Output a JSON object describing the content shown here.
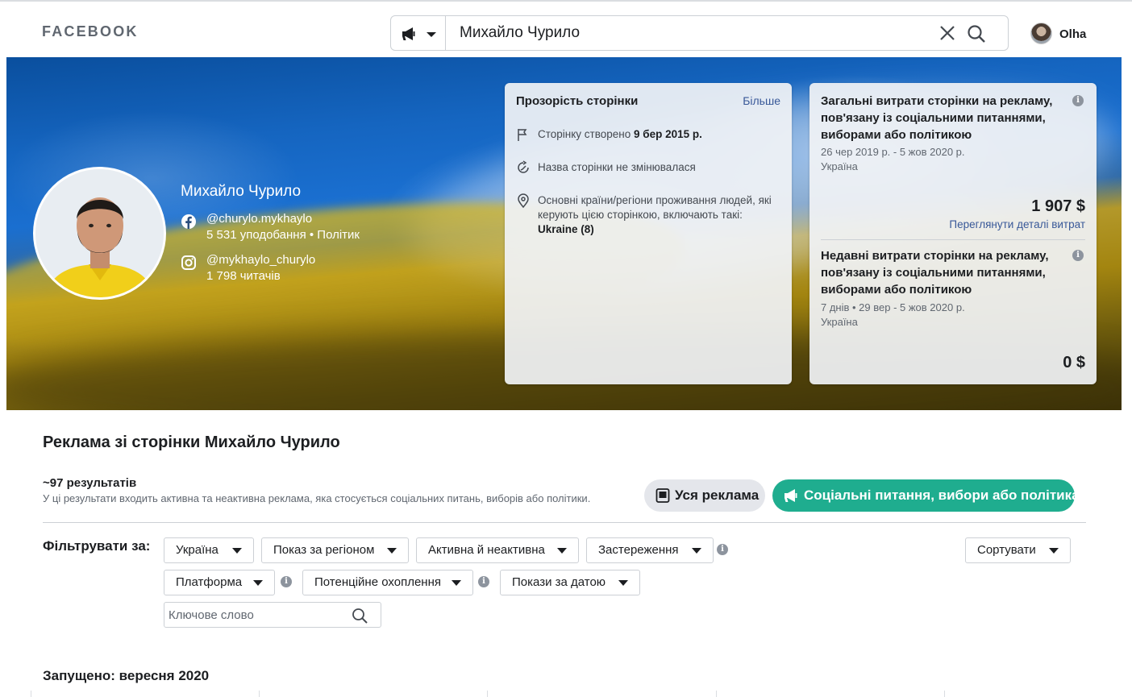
{
  "header": {
    "logo": "FACEBOOK",
    "search_value": "Михайло Чурило",
    "search_type_icon": "megaphone-icon",
    "user_name": "Olha"
  },
  "profile": {
    "name": "Михайло Чурило",
    "facebook_handle": "@churylo.mykhaylo",
    "facebook_stats": "5 531 уподобання • Політик",
    "instagram_handle": "@mykhaylo_churylo",
    "instagram_stats": "1 798 читачів"
  },
  "transparency": {
    "title": "Прозорість сторінки",
    "more": "Більше",
    "created_prefix": "Сторінку створено",
    "created_date": "9 бер 2015 р.",
    "name_unchanged": "Назва сторінки не змінювалася",
    "countries_text": "Основні країни/регіони проживання людей, які керують цією сторінкою, включають такі:",
    "countries_value": "Ukraine (8)"
  },
  "spending": {
    "total_title": "Загальні витрати сторінки на рекламу, пов'язану із соціальними питаннями, виборами або політикою",
    "total_period": "26 чер 2019 р. - 5 жов 2020 р.",
    "total_region": "Україна",
    "total_amount": "1 907 $",
    "details_link": "Переглянути деталі витрат",
    "recent_title": "Недавні витрати сторінки на рекламу, пов'язану із соціальними питаннями, виборами або політикою",
    "recent_period": "7 днів • 29 вер - 5 жов 2020 р.",
    "recent_region": "Україна",
    "recent_amount": "0 $"
  },
  "ads": {
    "title": "Реклама зі сторінки Михайло Чурило",
    "results": "~97 результатів",
    "results_desc": "У ці результати входить активна та неактивна реклама, яка стосується соціальних питань, виборів або політики.",
    "all_ads": "Уся реклама",
    "political_ads": "Соціальні питання, вибори або політика"
  },
  "filters": {
    "label": "Фільтрувати за:",
    "country": "Україна",
    "region": "Показ за регіоном",
    "status": "Активна й неактивна",
    "disclaimer": "Застереження",
    "sort": "Сортувати",
    "platform": "Платформа",
    "reach": "Потенційне охоплення",
    "date": "Покази за датою",
    "keyword_placeholder": "Ключове слово",
    "info_glyph": "i"
  },
  "launched": "Запущено: вересня 2020",
  "colors": {
    "accent_green": "#1fad8f",
    "link_blue": "#385898"
  }
}
